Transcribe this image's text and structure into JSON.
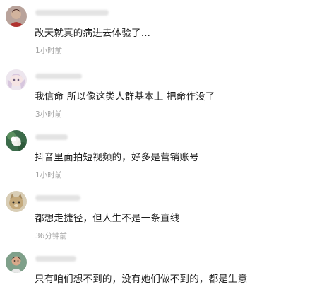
{
  "comments": [
    {
      "text": "改天就真的病进去体验了...",
      "time": "1小时前",
      "avatar_icon": "avatar-red-figure-icon"
    },
    {
      "text": "我信命 所以像这类人群基本上 把命作没了",
      "time": "3小时前",
      "avatar_icon": "avatar-anime-girl-icon"
    },
    {
      "text": "抖音里面拍短视频的，好多是营销账号",
      "time": "1小时前",
      "avatar_icon": "avatar-flower-icon"
    },
    {
      "text": "都想走捷径，但人生不是一条直线",
      "time": "36分钟前",
      "avatar_icon": "avatar-cat-icon"
    },
    {
      "text": "只有咱们想不到的，没有她们做不到的，都是生意",
      "time": "",
      "avatar_icon": "avatar-boy-icon"
    }
  ],
  "colors": {
    "text": "#1e1e1e",
    "time": "#a3a3a3",
    "username_blur": "#e3e3e3"
  }
}
